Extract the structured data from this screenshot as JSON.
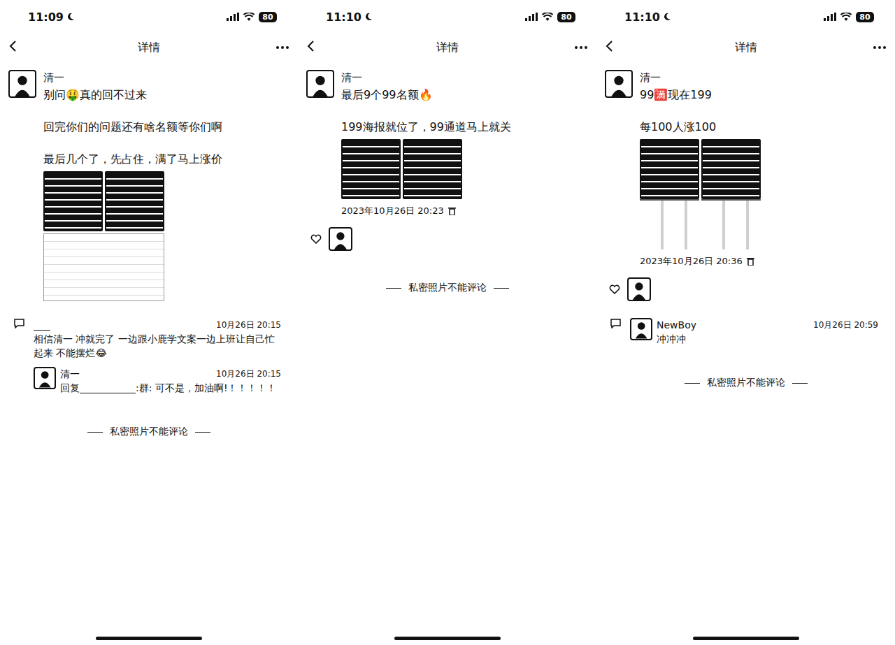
{
  "panels": [
    {
      "status": {
        "time": "11:09",
        "battery": "80"
      },
      "nav": {
        "title": "详情"
      },
      "post": {
        "author": "清一",
        "paragraphs": [
          "别问🤑真的回不过来",
          "回完你们的问题还有啥名额等你们啊",
          "最后几个了，先占住，满了马上涨价"
        ],
        "images": [
          {
            "kind": "poster"
          },
          {
            "kind": "poster"
          },
          {
            "kind": "screenshot"
          }
        ]
      },
      "likers": [],
      "comments": [
        {
          "kind": "plain",
          "redacted": true,
          "time": "10月26日 20:15",
          "text": "相信清一 冲就完了 一边跟小鹿学文案一边上班让自己忙起来 不能摆烂😂"
        },
        {
          "kind": "avatar",
          "author": "清一",
          "time": "10月26日 20:15",
          "prefix": "回复",
          "redacted": true,
          "text": ":群: 可不是，加油啊!！！！！！"
        }
      ],
      "footer": "私密照片不能评论"
    },
    {
      "status": {
        "time": "11:10",
        "battery": "80"
      },
      "nav": {
        "title": "详情"
      },
      "post": {
        "author": "清一",
        "paragraphs": [
          "最后9个99名额🔥",
          "199海报就位了，99通道马上就关"
        ],
        "images": [
          {
            "kind": "poster"
          },
          {
            "kind": "poster"
          }
        ],
        "timestamp": "2023年10月26日 20:23"
      },
      "likers": [
        {
          "kind": "avatar"
        }
      ],
      "comments": [],
      "footer": "私密照片不能评论"
    },
    {
      "status": {
        "time": "11:10",
        "battery": "80"
      },
      "nav": {
        "title": "详情"
      },
      "post": {
        "author": "清一",
        "paragraphs": [
          "99🈵现在199",
          "每100人涨100"
        ],
        "images": [
          {
            "kind": "poster-long"
          },
          {
            "kind": "poster-long"
          }
        ],
        "timestamp": "2023年10月26日 20:36"
      },
      "likers": [
        {
          "kind": "avatar"
        }
      ],
      "comments": [
        {
          "kind": "avatar",
          "author": "NewBoy",
          "time": "10月26日 20:59",
          "redacted": false,
          "text": "冲冲冲"
        }
      ],
      "footer": "私密照片不能评论"
    }
  ]
}
